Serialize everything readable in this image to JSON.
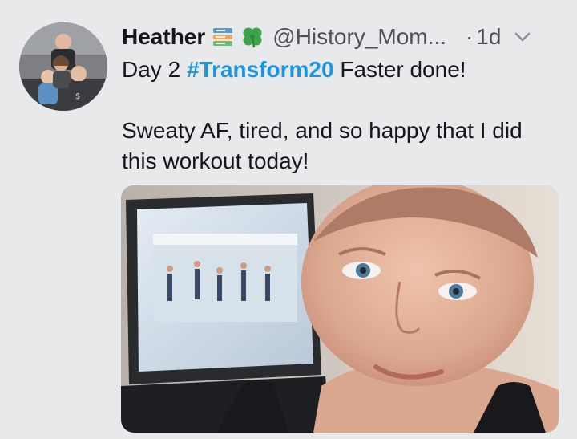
{
  "tweet": {
    "display_name": "Heather",
    "name_emojis": [
      "books-emoji",
      "shamrock-emoji"
    ],
    "handle": "@History_Mom...",
    "separator": "·",
    "time": "1d",
    "text_line1_before": "Day 2 ",
    "hashtag": "#Transform20",
    "text_line1_after": " Faster done!",
    "text_paragraph2": "Sweaty AF, tired, and so happy that I did this workout today!"
  },
  "colors": {
    "hashtag": "#1b95e0",
    "text": "#14171a",
    "muted": "#4a5056",
    "background": "#e8e9eb"
  },
  "icons": {
    "menu": "chevron-down-icon"
  }
}
